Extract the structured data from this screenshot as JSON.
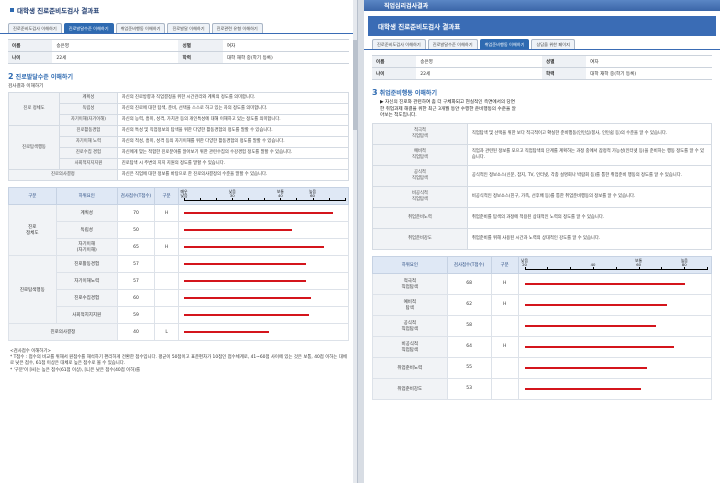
{
  "left": {
    "title": "대학생 진로준비도검사 결과표",
    "tabs": [
      "진로준비도검사 이해하기",
      "진로발달수준 이해하기",
      "취업준비행동 이해하기",
      "진로발달 이해하기",
      "진로관련 유형 이해하기"
    ],
    "active_tab": 1,
    "info": [
      {
        "k1": "이름",
        "v1": "송은영",
        "k2": "성별",
        "v2": "여자"
      },
      {
        "k1": "나이",
        "v1": "22세",
        "k2": "학력",
        "v2": "대학 재학 중(학기 등록)"
      }
    ],
    "section_num": "2",
    "section_title": "진로발달수준 이해하기",
    "section_sub": "검사결과 이해하기",
    "defs": [
      {
        "cat": "진로 정체도",
        "rows": [
          {
            "sub": "계획성",
            "text": "자신의 진로방향과 직업결정을 위한 시간관리와 계획의 정도를 의미합니다."
          },
          {
            "sub": "독립성",
            "text": "자신의 진로에 대한 탐색, 준비, 선택을 스스로 하고 있는 자의 정도를 의미합니다."
          },
          {
            "sub": "자기이해(자기이해)",
            "text": "자신의 능력, 흥미, 성격, 가치관 등의 개인특성에 대해 이해하고 있는 정도를 의미합니다."
          }
        ]
      },
      {
        "cat": "진로탐색행동",
        "rows": [
          {
            "sub": "진로활동경험",
            "text": "자신의 특성 및 직업정보의 탐색을 위한 다양한 활동경험의 정도를 말할 수 있습니다."
          },
          {
            "sub": "자기이해 노력",
            "text": "자신의 적성, 흥미, 성격 등의 자기이해를 위한 다양한 활동경험의 정도를 말할 수 있습니다."
          },
          {
            "sub": "진로수집 경험",
            "text": "자신에게 맞는 적합한 진로분야를 알아보기 위한 관련수집의 수강경험 정도를 말할 수 있습니다."
          },
          {
            "sub": "사회적지지지원",
            "text": "진로탐색 시 주변의 지지 지원의 정도를 말할 수 있습니다."
          }
        ]
      },
      {
        "cat": "진로의사결정",
        "rows": [
          {
            "sub": "",
            "text": "자신은 직업에 대한 정보를 바탕으로 한 진로의사결정의 수준을 말할 수 있습니다."
          }
        ]
      }
    ],
    "score_headers": [
      "구분",
      "하위요인",
      "검사점수(T점수)",
      "구분"
    ],
    "axis": [
      {
        "t": "매우\n낮음",
        "p": 0.0
      },
      {
        "t": "",
        "p": 0.1
      },
      {
        "t": "",
        "p": 0.2
      },
      {
        "t": "낮음\n30",
        "p": 0.3
      },
      {
        "t": "",
        "p": 0.4
      },
      {
        "t": "",
        "p": 0.5
      },
      {
        "t": "보통\n40",
        "p": 0.6
      },
      {
        "t": "",
        "p": 0.7
      },
      {
        "t": "높음\n60",
        "p": 0.8
      },
      {
        "t": "",
        "p": 0.9
      },
      {
        "t": "",
        "p": 1.0
      }
    ],
    "scores": [
      {
        "cat": "진로\n정체도",
        "span": 3,
        "sub": "계획성",
        "score": "70",
        "level": "H",
        "pct": 0.93
      },
      {
        "sub": "독립성",
        "score": "50",
        "level": "",
        "pct": 0.67
      },
      {
        "sub": "자기이해\n(자기이해)",
        "score": "65",
        "level": "H",
        "pct": 0.87
      },
      {
        "cat": "진로탐색행동",
        "span": 4,
        "sub": "진로활동경험",
        "score": "57",
        "level": "",
        "pct": 0.76
      },
      {
        "sub": "자기이해노력",
        "score": "57",
        "level": "",
        "pct": 0.76
      },
      {
        "sub": "진로수집경험",
        "score": "60",
        "level": "",
        "pct": 0.79
      },
      {
        "sub": "사회적지지지원",
        "score": "59",
        "level": "",
        "pct": 0.78
      },
      {
        "cat": "진로의사결정",
        "span": 1,
        "sub": "",
        "score": "40",
        "level": "L",
        "pct": 0.53
      }
    ],
    "notes": [
      "<검사점수 이해하기>",
      "* T점수 : 점수의 비교를 위해서 원점수를 해석하기 편리하게 전환한 점수입니다. 평균이 50점이고 표준편차가 10점인 점수체계로, 41~60점 사이에 있는 것은 보통, 40점 이하는 대체로 낮은 점수, 61점 이상은 대체로 높은 점수로 볼 수 있습니다.",
      "* '구분'이 [H]는 높은 점수(61점 이상), [L]은 낮은 점수(40점 이하)를"
    ]
  },
  "right": {
    "top_title": "직업심리검사결과",
    "title": "대학생 진로준비도검사 결과표",
    "tabs": [
      "진로준비도검사 이해하기",
      "진로발달수준 이해하기",
      "취업준비행동 이해하기",
      "상담을 위한 페이지"
    ],
    "active_tab": 2,
    "info": [
      {
        "k1": "이름",
        "v1": "송은영",
        "k2": "성별",
        "v2": "여자"
      },
      {
        "k1": "나이",
        "v1": "22세",
        "k2": "학력",
        "v2": "대학 재학 중(학기 등록)"
      }
    ],
    "section_num": "3",
    "section_title": "취업준비행동 이해하기",
    "intro": [
      "▶ 자신의 진로와 관련하여 좀 더 구체화되고 현실적인 측면에서의 당면",
      "한 취업과제 해결을 위한 최근 3개월 동안 수행한 준비행동의 수준을 알",
      "아보는 척도입니다."
    ],
    "defs": [
      {
        "sub": "적극적\n직업탐색",
        "text": "직업탐색 및 선택을 위한 보다 적극적이고 확실한 준비행동(인턴십/봉사, 인턴쉽 등)의 수준을 알 수 있습니다."
      },
      {
        "sub": "예비적\n직업탐색",
        "text": "직업과 관련된 정보를 모으고 직업탐색의 단계를 계획하는 과정 중에서 잠정적 가능성(인터넷 등)을 준비하는 행동 정도를 알 수 있습니다."
      },
      {
        "sub": "공식적\n직업탐색",
        "text": "공식적인 정보소스(신문, 잡지, TV, 인터넷, 각종 설명회나 박람회 등)를 통한 취업준비 행동의 정도를 알 수 있습니다."
      },
      {
        "sub": "비공식적\n직업탐색",
        "text": "비공식적인 정보소스(친구, 가족, 선후배 등)를 통한 취업준비행동의 정보를 알 수 있습니다."
      },
      {
        "sub": "취업준비노력",
        "text": "취업준비를 탐색의 과정에 적용된 상대적인 노력의 정도를 알 수 있습니다."
      },
      {
        "sub": "취업준비강도",
        "text": "취업준비를 위해 사용된 시간과 노력의 상대적인 강도를 알 수 있습니다."
      }
    ],
    "score_headers": [
      "하위요인",
      "검사점수(T점수)",
      "구분"
    ],
    "axis": [
      {
        "t": "낮음\n20",
        "p": 0.0
      },
      {
        "t": "",
        "p": 0.125
      },
      {
        "t": "",
        "p": 0.25
      },
      {
        "t": "40",
        "p": 0.375
      },
      {
        "t": "",
        "p": 0.5
      },
      {
        "t": "보통\n60",
        "p": 0.625
      },
      {
        "t": "",
        "p": 0.75
      },
      {
        "t": "높음\n80",
        "p": 0.875
      },
      {
        "t": "",
        "p": 1.0
      }
    ],
    "scores": [
      {
        "sub": "적극적\n직업탐색",
        "score": "68",
        "level": "H",
        "pct": 0.88
      },
      {
        "sub": "예비적\n탐색",
        "score": "62",
        "level": "H",
        "pct": 0.78
      },
      {
        "sub": "공식적\n직업탐색",
        "score": "58",
        "level": "",
        "pct": 0.72
      },
      {
        "sub": "비공식적\n직업탐색",
        "score": "64",
        "level": "H",
        "pct": 0.82
      },
      {
        "sub": "취업준비노력",
        "score": "55",
        "level": "",
        "pct": 0.67
      },
      {
        "sub": "취업준비강도",
        "score": "53",
        "level": "",
        "pct": 0.64
      }
    ]
  }
}
